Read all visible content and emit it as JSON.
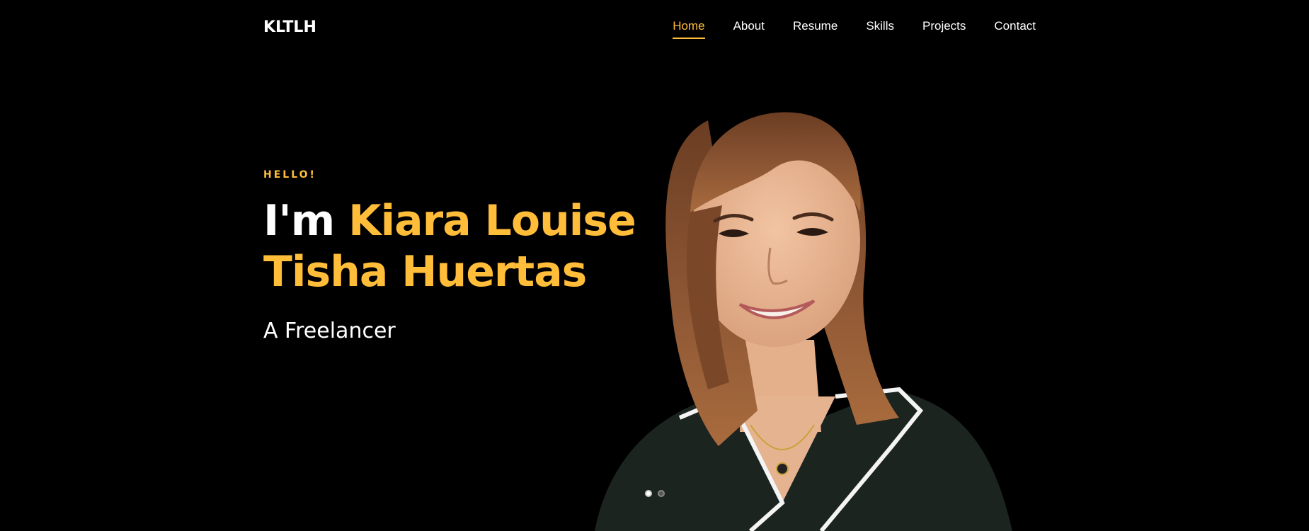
{
  "header": {
    "brand": "KLTLH",
    "nav": [
      {
        "label": "Home",
        "active": true
      },
      {
        "label": "About",
        "active": false
      },
      {
        "label": "Resume",
        "active": false
      },
      {
        "label": "Skills",
        "active": false
      },
      {
        "label": "Projects",
        "active": false
      },
      {
        "label": "Contact",
        "active": false
      }
    ]
  },
  "hero": {
    "greeting": "HELLO!",
    "lead": "I'm ",
    "name": "Kiara Louise Tisha Huertas",
    "subtitle": "A Freelancer"
  },
  "slider": {
    "dots": 2,
    "active_index": 0
  },
  "colors": {
    "background": "#000000",
    "accent": "#ffbd39",
    "text": "#ffffff"
  }
}
